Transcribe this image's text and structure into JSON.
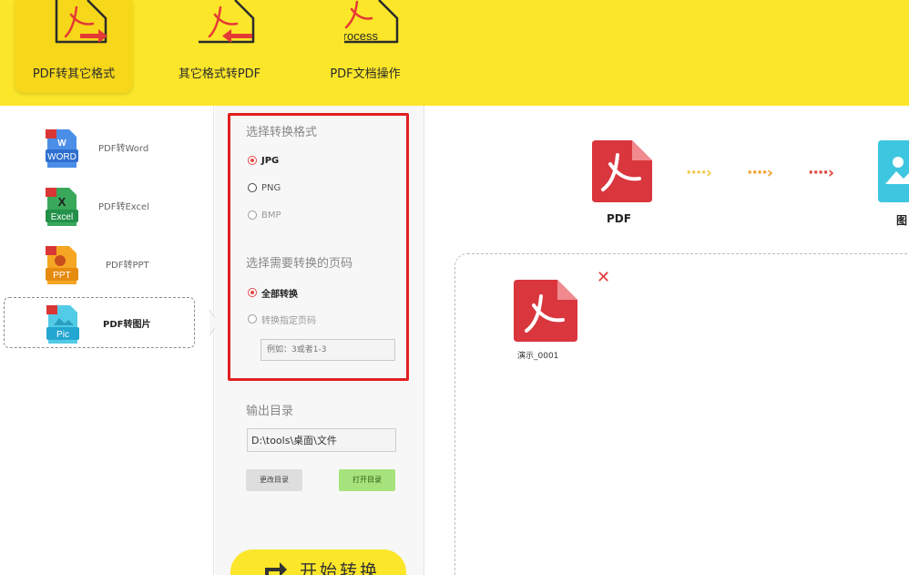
{
  "toolbar": {
    "tabs": [
      {
        "label": "PDF转其它格式",
        "icon": "pdf-to-other-icon"
      },
      {
        "label": "其它格式转PDF",
        "icon": "other-to-pdf-icon"
      },
      {
        "label": "PDF文档操作",
        "icon": "pdf-process-icon",
        "badge": "Process"
      }
    ],
    "active_tab": 0
  },
  "sidebar": {
    "items": [
      {
        "label": "PDF转Word",
        "badge": "WORD"
      },
      {
        "label": "PDF转Excel",
        "badge": "Excel"
      },
      {
        "label": "PDF转PPT",
        "badge": "PPT"
      },
      {
        "label": "PDF转图片",
        "badge": "Pic"
      }
    ],
    "active_item": 3
  },
  "options": {
    "format_title": "选择转换格式",
    "formats": [
      {
        "label": "JPG",
        "checked": true
      },
      {
        "label": "PNG",
        "checked": false
      },
      {
        "label": "BMP",
        "checked": false
      }
    ],
    "page_title": "选择需要转换的页码",
    "page_modes": [
      {
        "label": "全部转换",
        "checked": true
      },
      {
        "label": "转换指定页码",
        "checked": false
      }
    ],
    "page_placeholder": "例如：3或者1-3",
    "output_title": "输出目录",
    "output_path": "D:\\tools\\桌面\\文件",
    "change_dir_label": "更改目录",
    "open_dir_label": "打开目录",
    "start_label": "开始转换"
  },
  "main": {
    "flow": {
      "from_label": "PDF",
      "to_label": "图"
    },
    "files": [
      {
        "name": "演示_0001"
      }
    ]
  },
  "colors": {
    "toolbar_bg": "#fbe62a",
    "pdf_red": "#d9363e",
    "highlight": "#e02020",
    "open_button": "#a7e37c"
  }
}
